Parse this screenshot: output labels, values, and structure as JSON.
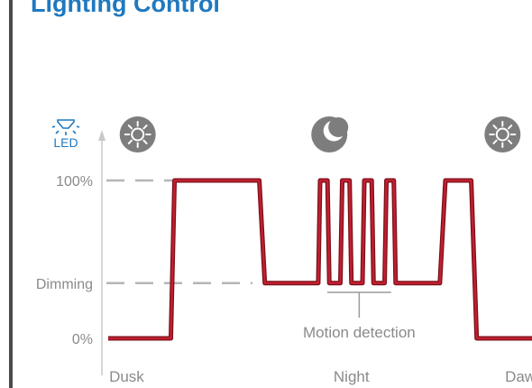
{
  "page": {
    "title": "Lighting Control"
  },
  "colors": {
    "title": "#1f79c0",
    "line": "#c21f31",
    "line_dark": "#7a1018",
    "icon": "#7d7d7d",
    "text": "#8a8a8a"
  },
  "chart_data": {
    "type": "line",
    "title": "",
    "legend": {
      "icon": "led-icon",
      "label": "LED"
    },
    "y_levels": [
      {
        "label": "100%",
        "value": 100
      },
      {
        "label": "Dimming",
        "value": 35
      },
      {
        "label": "0%",
        "value": 0
      }
    ],
    "x_labels": [
      {
        "label": "Dusk",
        "t": 0.5
      },
      {
        "label": "Night",
        "t": 6.6
      },
      {
        "label": "Dawn",
        "t": 11.3
      }
    ],
    "time_icons": [
      {
        "icon": "sun-icon",
        "t": 0.8
      },
      {
        "icon": "moon-icon",
        "t": 6.0
      },
      {
        "icon": "sun-icon",
        "t": 10.7
      }
    ],
    "xlim": [
      0,
      11.5
    ],
    "ylim": [
      0,
      100
    ],
    "series": [
      {
        "x": [
          0,
          1.7,
          1.8,
          4.1,
          4.25,
          5.7,
          5.75,
          5.95,
          6.0,
          6.3,
          6.35,
          6.55,
          6.6,
          6.9,
          6.95,
          7.15,
          7.2,
          7.5,
          7.55,
          7.75,
          7.8,
          9.0,
          9.15,
          9.85,
          10.0,
          11.5
        ],
        "y": [
          0,
          0,
          100,
          100,
          35,
          35,
          100,
          100,
          35,
          35,
          100,
          100,
          35,
          35,
          100,
          100,
          35,
          35,
          100,
          100,
          35,
          35,
          100,
          100,
          0,
          0
        ]
      }
    ],
    "annotations": [
      {
        "text": "Motion detection",
        "t_from": 5.7,
        "t_to": 7.8
      }
    ]
  }
}
